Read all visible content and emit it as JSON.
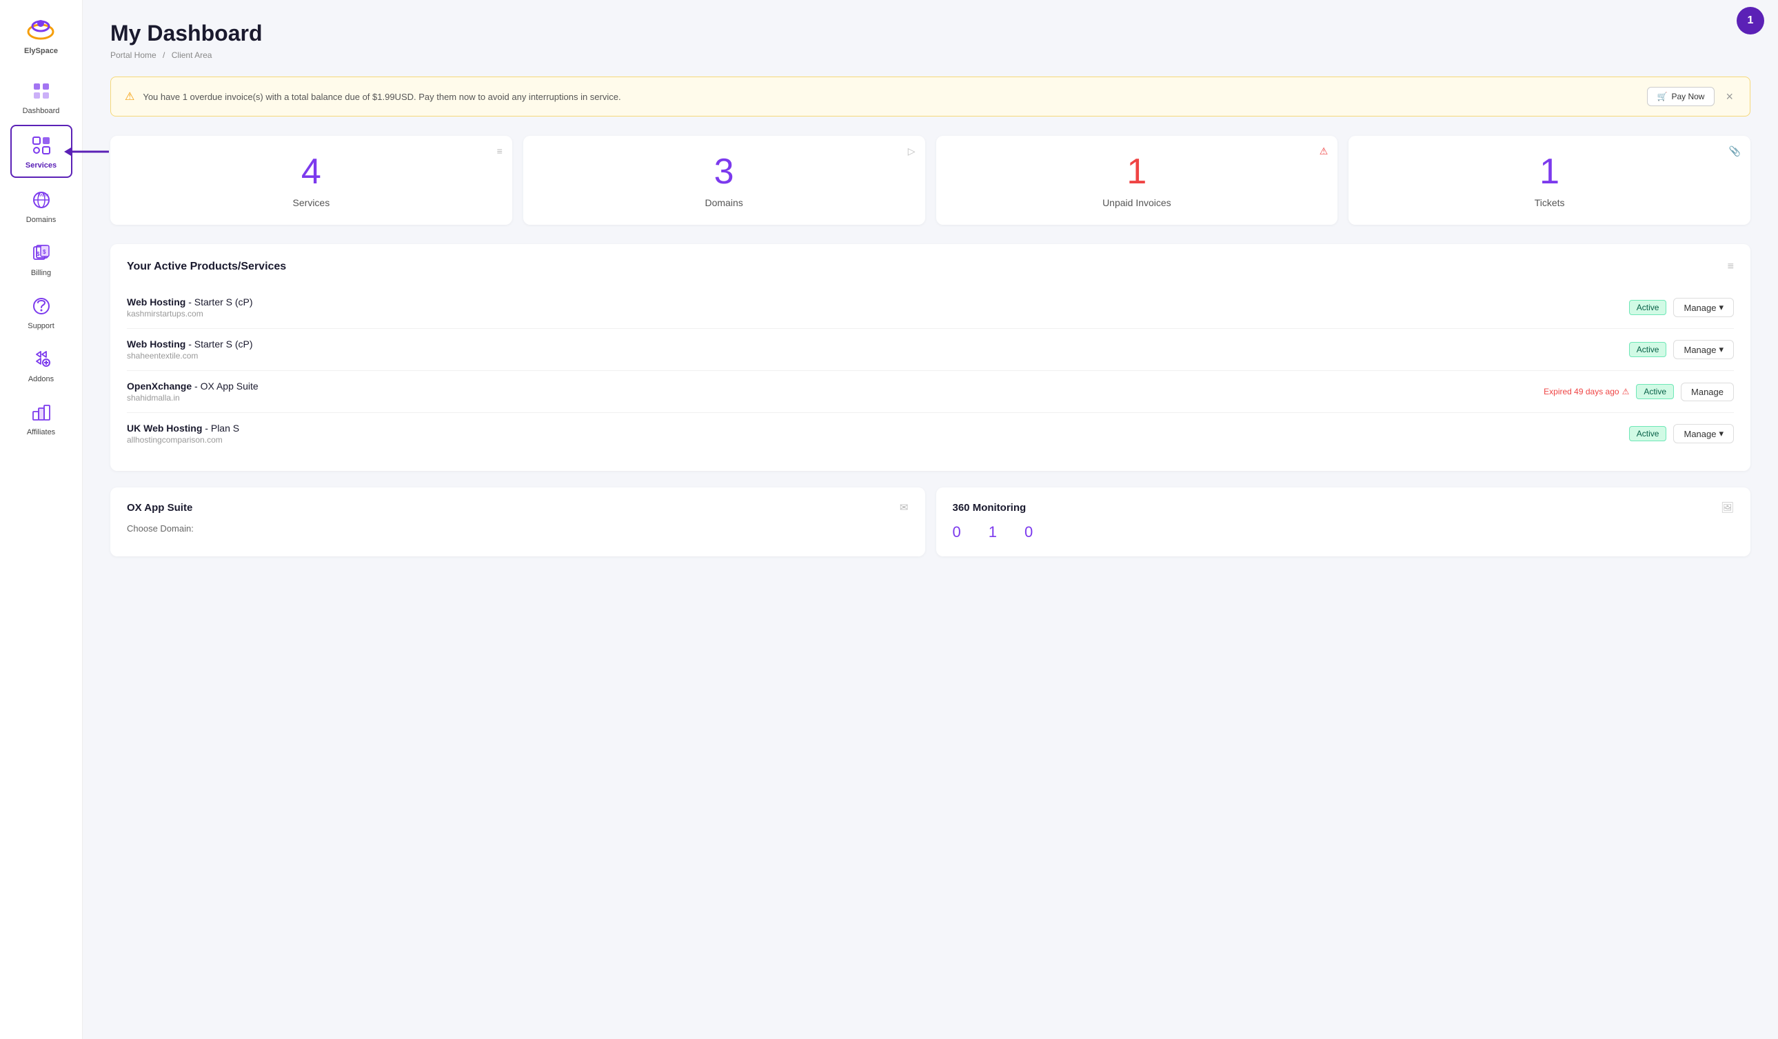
{
  "app": {
    "name": "ElySpace",
    "avatar_number": "1"
  },
  "sidebar": {
    "items": [
      {
        "id": "dashboard",
        "label": "Dashboard",
        "active": false
      },
      {
        "id": "services",
        "label": "Services",
        "active": true
      },
      {
        "id": "domains",
        "label": "Domains",
        "active": false
      },
      {
        "id": "billing",
        "label": "Billing",
        "active": false
      },
      {
        "id": "support",
        "label": "Support",
        "active": false
      },
      {
        "id": "addons",
        "label": "Addons",
        "active": false
      },
      {
        "id": "affiliates",
        "label": "Affiliates",
        "active": false
      }
    ]
  },
  "breadcrumb": {
    "home": "Portal Home",
    "current": "Client Area"
  },
  "page": {
    "title": "My Dashboard"
  },
  "alert": {
    "message": "You have 1 overdue invoice(s) with a total balance due of $1.99USD. Pay them now to avoid any interruptions in service.",
    "pay_button": "Pay Now"
  },
  "stats": [
    {
      "id": "services",
      "number": "4",
      "label": "Services",
      "color": "purple",
      "icon": "≡"
    },
    {
      "id": "domains",
      "number": "3",
      "label": "Domains",
      "color": "purple",
      "icon": "▷"
    },
    {
      "id": "invoices",
      "number": "1",
      "label": "Unpaid Invoices",
      "color": "red",
      "icon": "⚠"
    },
    {
      "id": "tickets",
      "number": "1",
      "label": "Tickets",
      "color": "purple",
      "icon": "📎"
    }
  ],
  "products_section": {
    "title": "Your Active Products/Services",
    "items": [
      {
        "name": "Web Hosting",
        "plan": "Starter S (cP)",
        "domain": "kashmirstartups.com",
        "status": "Active",
        "expired_text": null
      },
      {
        "name": "Web Hosting",
        "plan": "Starter S (cP)",
        "domain": "shaheentextile.com",
        "status": "Active",
        "expired_text": null
      },
      {
        "name": "OpenXchange",
        "plan": "OX App Suite",
        "domain": "shahidmalla.in",
        "status": "Active",
        "expired_text": "Expired 49 days ago"
      },
      {
        "name": "UK Web Hosting",
        "plan": "Plan S",
        "domain": "allhostingcomparison.com",
        "status": "Active",
        "expired_text": null
      }
    ],
    "manage_label": "Manage"
  },
  "bottom_sections": [
    {
      "id": "ox-app-suite",
      "title": "OX App Suite",
      "icon": "✉",
      "choose_domain_label": "Choose Domain:",
      "numbers": []
    },
    {
      "id": "360-monitoring",
      "title": "360 Monitoring",
      "icon": "🖼",
      "numbers": [
        {
          "value": "0",
          "label": ""
        },
        {
          "value": "1",
          "label": ""
        },
        {
          "value": "0",
          "label": ""
        }
      ]
    }
  ]
}
